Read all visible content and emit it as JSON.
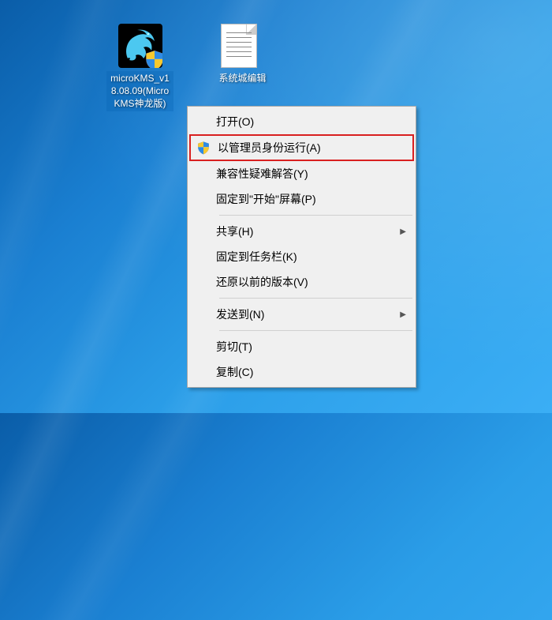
{
  "desktop": {
    "icons": [
      {
        "label": "microKMS_v18.08.09(MicroKMS神龙版)"
      },
      {
        "label": "系统城编辑"
      }
    ]
  },
  "context_menu": {
    "items": [
      {
        "label": "打开(O)",
        "icon": null,
        "submenu": false
      },
      {
        "label": "以管理员身份运行(A)",
        "icon": "shield",
        "submenu": false,
        "highlighted": true
      },
      {
        "label": "兼容性疑难解答(Y)",
        "icon": null,
        "submenu": false
      },
      {
        "label": "固定到\"开始\"屏幕(P)",
        "icon": null,
        "submenu": false
      },
      {
        "separator": true
      },
      {
        "label": "共享(H)",
        "icon": null,
        "submenu": true
      },
      {
        "label": "固定到任务栏(K)",
        "icon": null,
        "submenu": false
      },
      {
        "label": "还原以前的版本(V)",
        "icon": null,
        "submenu": false
      },
      {
        "separator": true
      },
      {
        "label": "发送到(N)",
        "icon": null,
        "submenu": true
      },
      {
        "separator": true
      },
      {
        "label": "剪切(T)",
        "icon": null,
        "submenu": false
      },
      {
        "label": "复制(C)",
        "icon": null,
        "submenu": false
      }
    ]
  },
  "colors": {
    "highlight": "#d92020"
  }
}
